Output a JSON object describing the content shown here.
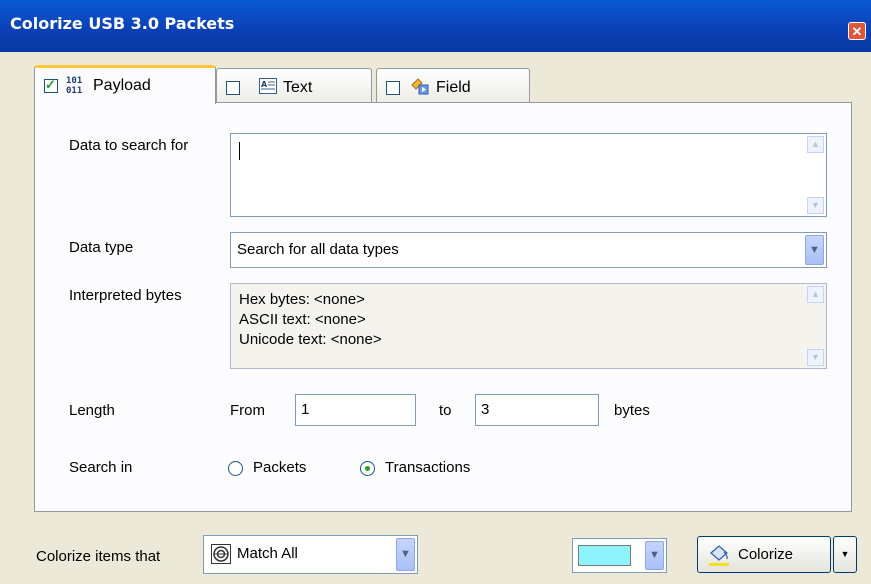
{
  "window": {
    "title": "Colorize USB 3.0 Packets",
    "close_glyph": "✕"
  },
  "tabs": [
    {
      "label": "Payload",
      "icon": "binary-icon",
      "checked": true,
      "active": true
    },
    {
      "label": "Text",
      "icon": "text-doc-icon",
      "checked": false,
      "active": false
    },
    {
      "label": "Field",
      "icon": "field-icon",
      "checked": false,
      "active": false
    }
  ],
  "payload": {
    "search_label": "Data to search for",
    "search_value": "",
    "type_label": "Data type",
    "type_value": "Search for all data types",
    "interp_label": "Interpreted bytes",
    "interp_lines": [
      "Hex bytes: <none>",
      "ASCII text: <none>",
      "Unicode text: <none>"
    ],
    "length_label": "Length",
    "from_label": "From",
    "from_value": "1",
    "to_label": "to",
    "to_value": "3",
    "bytes_label": "bytes",
    "searchin_label": "Search in",
    "searchin_options": [
      "Packets",
      "Transactions"
    ],
    "searchin_selected": "Transactions"
  },
  "footer": {
    "colorize_items_label": "Colorize items that",
    "match_value": "Match All",
    "color_swatch": "#8ef3fb",
    "colorize_button": "Colorize"
  },
  "colors": {
    "title_bar": "#0b3fb4",
    "active_tab_highlight": "#ffc83c",
    "selected_radio": "#21a121"
  }
}
